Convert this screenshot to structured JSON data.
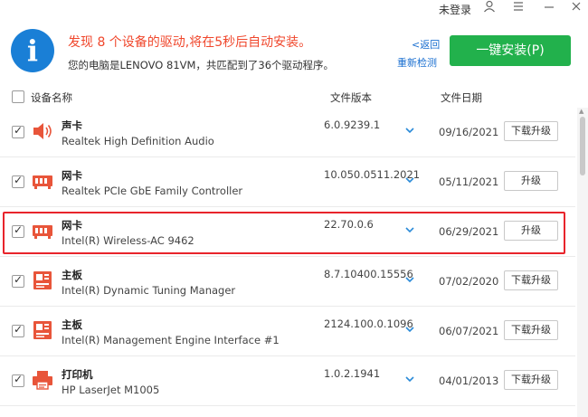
{
  "titlebar": {
    "user_label": "未登录",
    "icons": [
      "user-icon",
      "menu-icon",
      "minimize-icon",
      "close-icon"
    ]
  },
  "header": {
    "icon_glyph": "i",
    "notice": "发现 8 个设备的驱动,将在5秒后自动安装。",
    "subnotice": "您的电脑是LENOVO 81VM，共匹配到了36个驱动程序。",
    "back_link": "<返回",
    "recheck_link": "重新检测",
    "install_button": "一键安装(P)"
  },
  "columns": {
    "name": "设备名称",
    "version": "文件版本",
    "date": "文件日期"
  },
  "rows": [
    {
      "type": "声卡",
      "model": "Realtek High Definition Audio",
      "version": "6.0.9239.1",
      "date": "09/16/2021",
      "action": "下载升级",
      "icon": "speaker-icon",
      "checked": true
    },
    {
      "type": "网卡",
      "model": "Realtek PCIe GbE Family Controller",
      "version": "10.050.0511.2021",
      "date": "05/11/2021",
      "action": "升级",
      "icon": "network-card-icon",
      "checked": true
    },
    {
      "type": "网卡",
      "model": "Intel(R) Wireless-AC 9462",
      "version": "22.70.0.6",
      "date": "06/29/2021",
      "action": "升级",
      "icon": "network-card-icon",
      "checked": true
    },
    {
      "type": "主板",
      "model": "Intel(R) Dynamic Tuning Manager",
      "version": "8.7.10400.15556",
      "date": "07/02/2020",
      "action": "下载升级",
      "icon": "motherboard-icon",
      "checked": true
    },
    {
      "type": "主板",
      "model": "Intel(R) Management Engine Interface #1",
      "version": "2124.100.0.1096",
      "date": "06/07/2021",
      "action": "下载升级",
      "icon": "motherboard-icon",
      "checked": true
    },
    {
      "type": "打印机",
      "model": "HP LaserJet M1005",
      "version": "1.0.2.1941",
      "date": "04/01/2013",
      "action": "下载升级",
      "icon": "printer-icon",
      "checked": true
    }
  ],
  "colors": {
    "accent_blue": "#1a7fd6",
    "install_green": "#22b14c",
    "notice_red": "#f0472c",
    "highlight_red": "#e8242b",
    "device_icon_red": "#e8553a"
  }
}
